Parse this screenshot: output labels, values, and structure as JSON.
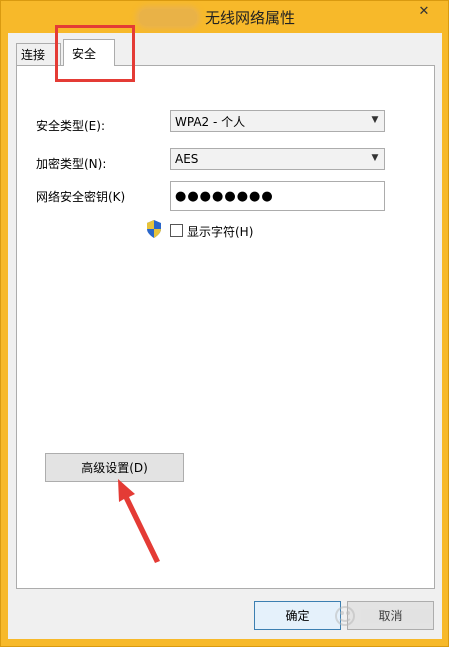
{
  "window": {
    "title": "无线网络属性",
    "close_glyph": "✕"
  },
  "tabs": [
    {
      "label": "连接",
      "selected": false
    },
    {
      "label": "安全",
      "selected": true
    }
  ],
  "form": {
    "security_type_label": "安全类型(E):",
    "security_type_value": "WPA2 - 个人",
    "encryption_type_label": "加密类型(N):",
    "encryption_type_value": "AES",
    "key_label": "网络安全密钥(K)",
    "key_value": "●●●●●●●●",
    "show_chars_label": "显示字符(H)",
    "show_chars_checked": false
  },
  "buttons": {
    "advanced": "高级设置(D)",
    "ok": "确定",
    "cancel": "取消"
  },
  "annotations": {
    "highlight_color": "#e43b35"
  },
  "colors": {
    "titlebar": "#f7b92a",
    "dialog_bg": "#f0f0f0"
  }
}
